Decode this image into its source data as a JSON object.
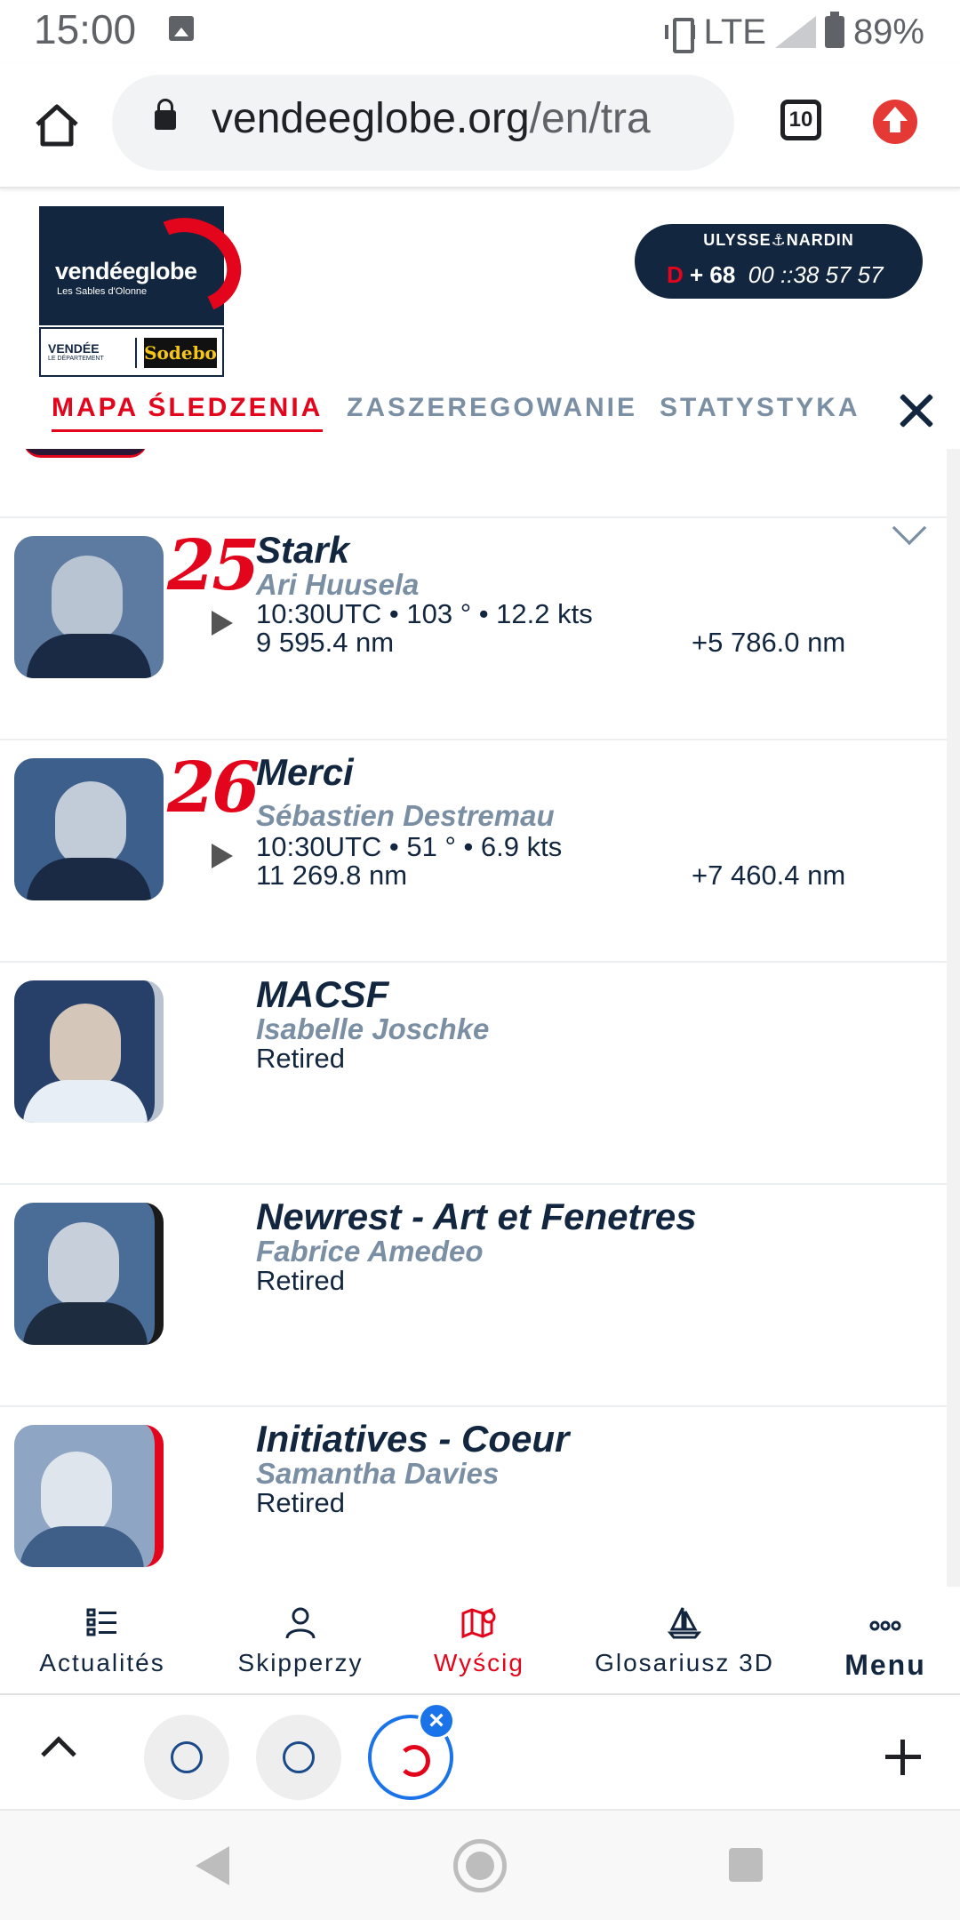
{
  "status_bar": {
    "time": "15:00",
    "network": "LTE",
    "battery": "89%"
  },
  "browser": {
    "url_main": "vendeeglobe.org",
    "url_path": "/en/tra",
    "tab_count": "10"
  },
  "site": {
    "logo_text": "vendéeglobe",
    "logo_sub": "Les Sables d'Olonne",
    "sponsor1": "VENDÉE",
    "sponsor1_sub": "LE DÉPARTEMENT",
    "sponsor2": "Sodebo",
    "timer_brand": "ULYSSE⚓NARDIN",
    "timer_prefix": "D",
    "timer_days": "+ 68",
    "timer_time": "00 ::38  57 57"
  },
  "tabs": {
    "tracking": "MAPA ŚLEDZENIA",
    "ranking": "ZASZEREGOWANIE",
    "stats": "STATYSTYKA"
  },
  "entries": [
    {
      "rank": "25",
      "boat": "Stark",
      "skipper": "Ari Huusela",
      "line1": "10:30UTC • 103 ° • 12.2 kts",
      "line2": "9 595.4 nm",
      "gap": "+5 786.0 nm"
    },
    {
      "rank": "26",
      "boat": "Merci",
      "skipper": "Sébastien Destremau",
      "line1": "10:30UTC • 51 ° • 6.9 kts",
      "line2": "11 269.8 nm",
      "gap": "+7 460.4 nm"
    },
    {
      "boat": "MACSF",
      "skipper": "Isabelle Joschke",
      "status": "Retired"
    },
    {
      "boat": "Newrest - Art et Fenetres",
      "skipper": "Fabrice Amedeo",
      "status": "Retired"
    },
    {
      "boat": "Initiatives - Coeur",
      "skipper": "Samantha Davies",
      "status": "Retired"
    }
  ],
  "bottom_nav": {
    "news": "Actualités",
    "skippers": "Skipperzy",
    "race": "Wyścig",
    "glossary": "Glosariusz 3D",
    "menu": "Menu"
  },
  "colors": {
    "navy": "#12263f",
    "red": "#e3051b",
    "grey": "#7a8fa3"
  }
}
